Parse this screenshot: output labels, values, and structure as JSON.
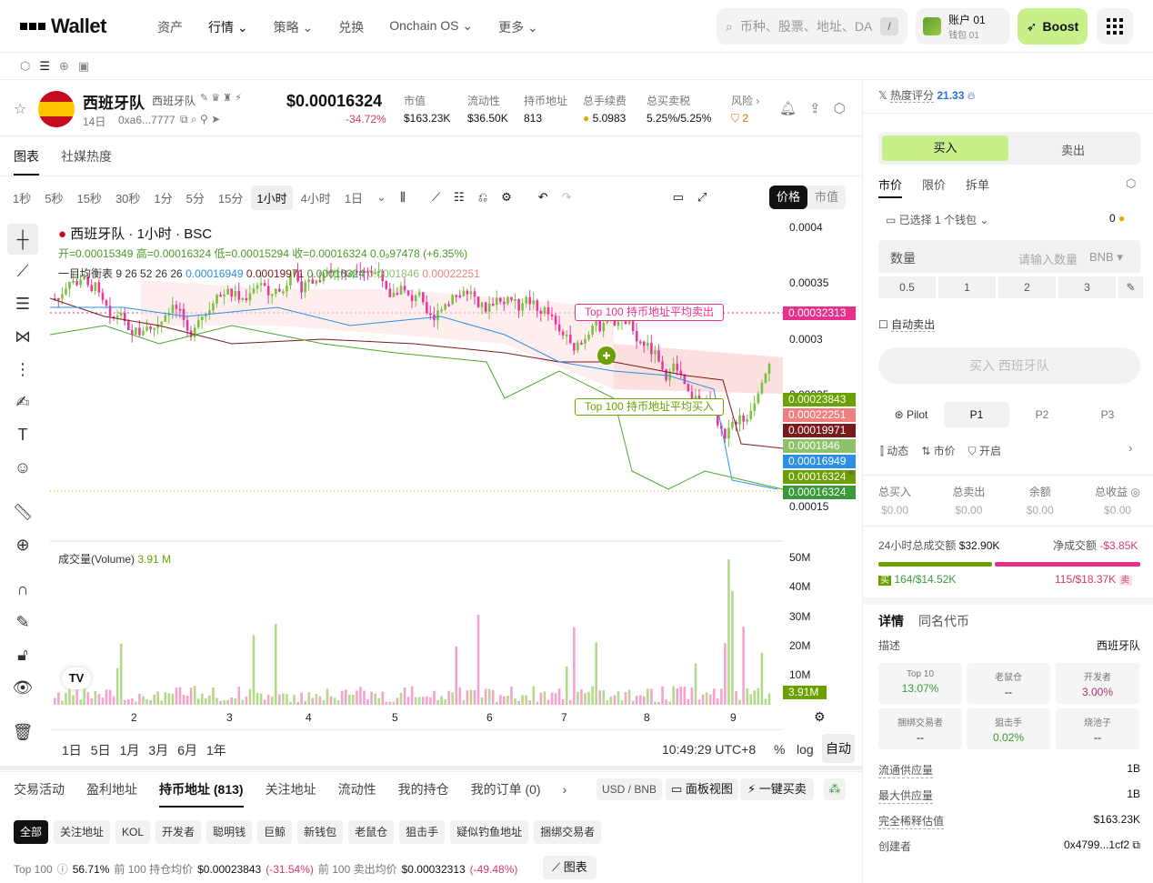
{
  "nav": {
    "logo": "Wallet",
    "items": [
      "资产",
      "行情",
      "策略",
      "兑换",
      "Onchain OS",
      "更多"
    ],
    "search_placeholder": "币种、股票、地址、DA",
    "search_key": "/",
    "account_name": "账户 01",
    "account_sub": "钱包 01",
    "boost": "Boost"
  },
  "token": {
    "name": "西班牙队",
    "sub": "西班牙队",
    "age": "14日",
    "address": "0xa6...7777",
    "price": "$0.00016324",
    "change": "-34.72%",
    "stats": [
      {
        "label": "市值",
        "value": "$163.23K"
      },
      {
        "label": "流动性",
        "value": "$36.50K"
      },
      {
        "label": "持币地址",
        "value": "813"
      },
      {
        "label": "总手续费",
        "value": "5.0983"
      },
      {
        "label": "总买卖税",
        "value": "5.25%/5.25%"
      },
      {
        "label": "风险",
        "value": "2"
      }
    ]
  },
  "chart_tabs": [
    "图表",
    "社媒热度"
  ],
  "intervals": [
    "1秒",
    "5秒",
    "15秒",
    "30秒",
    "1分",
    "5分",
    "15分",
    "1小时",
    "4小时",
    "1日"
  ],
  "selected_interval": "1小时",
  "price_mode": [
    "价格",
    "市值"
  ],
  "legend": {
    "title": "西班牙队 · 1小时 · BSC",
    "ohlc": "开=0.00015349 高=0.00016324 低=0.00015294 收=0.00016324 0.0₉97478 (+6.35%)",
    "ichimoku_label": "一目均衡表 9 26 52 26 26",
    "ichimoku_vals": [
      "0.00016949",
      "0.00019971",
      "0.00016324",
      "0.0001846",
      "0.00022251"
    ],
    "volume_label": "成交量(Volume)",
    "volume_val": "3.91 M"
  },
  "annotations": {
    "sell": "Top 100 持币地址平均卖出",
    "buy": "Top 100 持币地址平均买入"
  },
  "y_labels": [
    "0.0004",
    "0.00035",
    "0.0003",
    "0.00025",
    "0.00015"
  ],
  "price_tags": [
    {
      "v": "0.00032313",
      "c": "#e8308c"
    },
    {
      "v": "0.00023843",
      "c": "#6aa000"
    },
    {
      "v": "0.00022251",
      "c": "#f08080"
    },
    {
      "v": "0.00019971",
      "c": "#7a1a1a"
    },
    {
      "v": "0.0001846",
      "c": "#8dc26b"
    },
    {
      "v": "0.00016949",
      "c": "#2b8fe8"
    },
    {
      "v": "0.00016324",
      "c": "#6aa000"
    },
    {
      "v": "0.00016324",
      "c": "#3a9a3a"
    }
  ],
  "vol_labels": [
    "50M",
    "40M",
    "30M",
    "20M",
    "10M"
  ],
  "vol_tag": "3.91M",
  "x_labels": [
    "2",
    "3",
    "4",
    "5",
    "6",
    "7",
    "8",
    "9"
  ],
  "ranges": [
    "1日",
    "5日",
    "1月",
    "3月",
    "6月",
    "1年"
  ],
  "time": "10:49:29 UTC+8",
  "scale": [
    "%",
    "log",
    "自动"
  ],
  "bottom_tabs": [
    "交易活动",
    "盈利地址",
    "持币地址 (813)",
    "关注地址",
    "流动性",
    "我的持仓",
    "我的订单 (0)"
  ],
  "bottom_right": {
    "currency": "USD / BNB",
    "panel": "面板视图",
    "quick": "一键买卖"
  },
  "chips": [
    "全部",
    "关注地址",
    "KOL",
    "开发者",
    "聪明钱",
    "巨鲸",
    "新钱包",
    "老鼠仓",
    "狙击手",
    "疑似钓鱼地址",
    "捆绑交易者"
  ],
  "summary": {
    "top": "Top 100",
    "top_val": "56.71%",
    "avg_hold_label": "前 100 持仓均价",
    "avg_hold": "$0.00023843",
    "avg_hold_chg": "(-31.54%)",
    "avg_sell_label": "前 100 卖出均价",
    "avg_sell": "$0.00032313",
    "avg_sell_chg": "(-49.48%)",
    "chart_btn": "图表"
  },
  "right": {
    "heat_label": "热度评分",
    "heat": "21.33",
    "buy": "买入",
    "sell": "卖出",
    "order_tabs": [
      "市价",
      "限价",
      "拆单"
    ],
    "wallet": "已选择 1 个钱包",
    "wallet_bal": "0",
    "qty": "数量",
    "qty_ph": "请输入数量",
    "qty_unit": "BNB",
    "quick": [
      "0.5",
      "1",
      "2",
      "3"
    ],
    "auto_sell": "自动卖出",
    "buy_btn": "买入 西班牙队",
    "presets": [
      "Pilot",
      "P1",
      "P2",
      "P3"
    ],
    "opts": [
      "动态",
      "市价",
      "开启"
    ],
    "totals": [
      {
        "k": "总买入",
        "v": "$0.00"
      },
      {
        "k": "总卖出",
        "v": "$0.00"
      },
      {
        "k": "余额",
        "v": "$0.00"
      },
      {
        "k": "总收益",
        "v": "$0.00"
      }
    ],
    "vol24_label": "24小时总成交额",
    "vol24": "$32.90K",
    "net_label": "净成交额",
    "net": "-$3.85K",
    "buy_stat": "164/$14.52K",
    "sell_stat": "115/$18.37K",
    "buy_tag": "买",
    "sell_tag": "卖",
    "detail_tabs": [
      "详情",
      "同名代币"
    ],
    "desc_label": "描述",
    "desc": "西班牙队",
    "cards": [
      {
        "k": "Top 10",
        "v": "13.07%",
        "c": "#3a9a3a"
      },
      {
        "k": "老鼠仓",
        "v": "--",
        "c": "#111"
      },
      {
        "k": "开发者",
        "v": "3.00%",
        "c": "#b0306c"
      },
      {
        "k": "捆绑交易者",
        "v": "--",
        "c": "#111"
      },
      {
        "k": "狙击手",
        "v": "0.02%",
        "c": "#3a9a3a"
      },
      {
        "k": "烧池子",
        "v": "--",
        "c": "#111"
      }
    ],
    "kv": [
      {
        "k": "流通供应量",
        "v": "1B"
      },
      {
        "k": "最大供应量",
        "v": "1B"
      },
      {
        "k": "完全稀释估值",
        "v": "$163.23K"
      },
      {
        "k": "创建者",
        "v": "0x4799...1cf2"
      }
    ]
  },
  "chart_data": {
    "type": "candlestick",
    "title": "西班牙队 · 1小时 · BSC",
    "x_ticks": [
      "2",
      "3",
      "4",
      "5",
      "6",
      "7",
      "8",
      "9"
    ],
    "y_ticks": [
      "0.0004",
      "0.00035",
      "0.0003",
      "0.00025",
      "0.00015"
    ],
    "last_close": 0.00016324,
    "volume_axis": [
      "50M",
      "40M",
      "30M",
      "20M",
      "10M"
    ],
    "last_volume": "3.91M"
  }
}
